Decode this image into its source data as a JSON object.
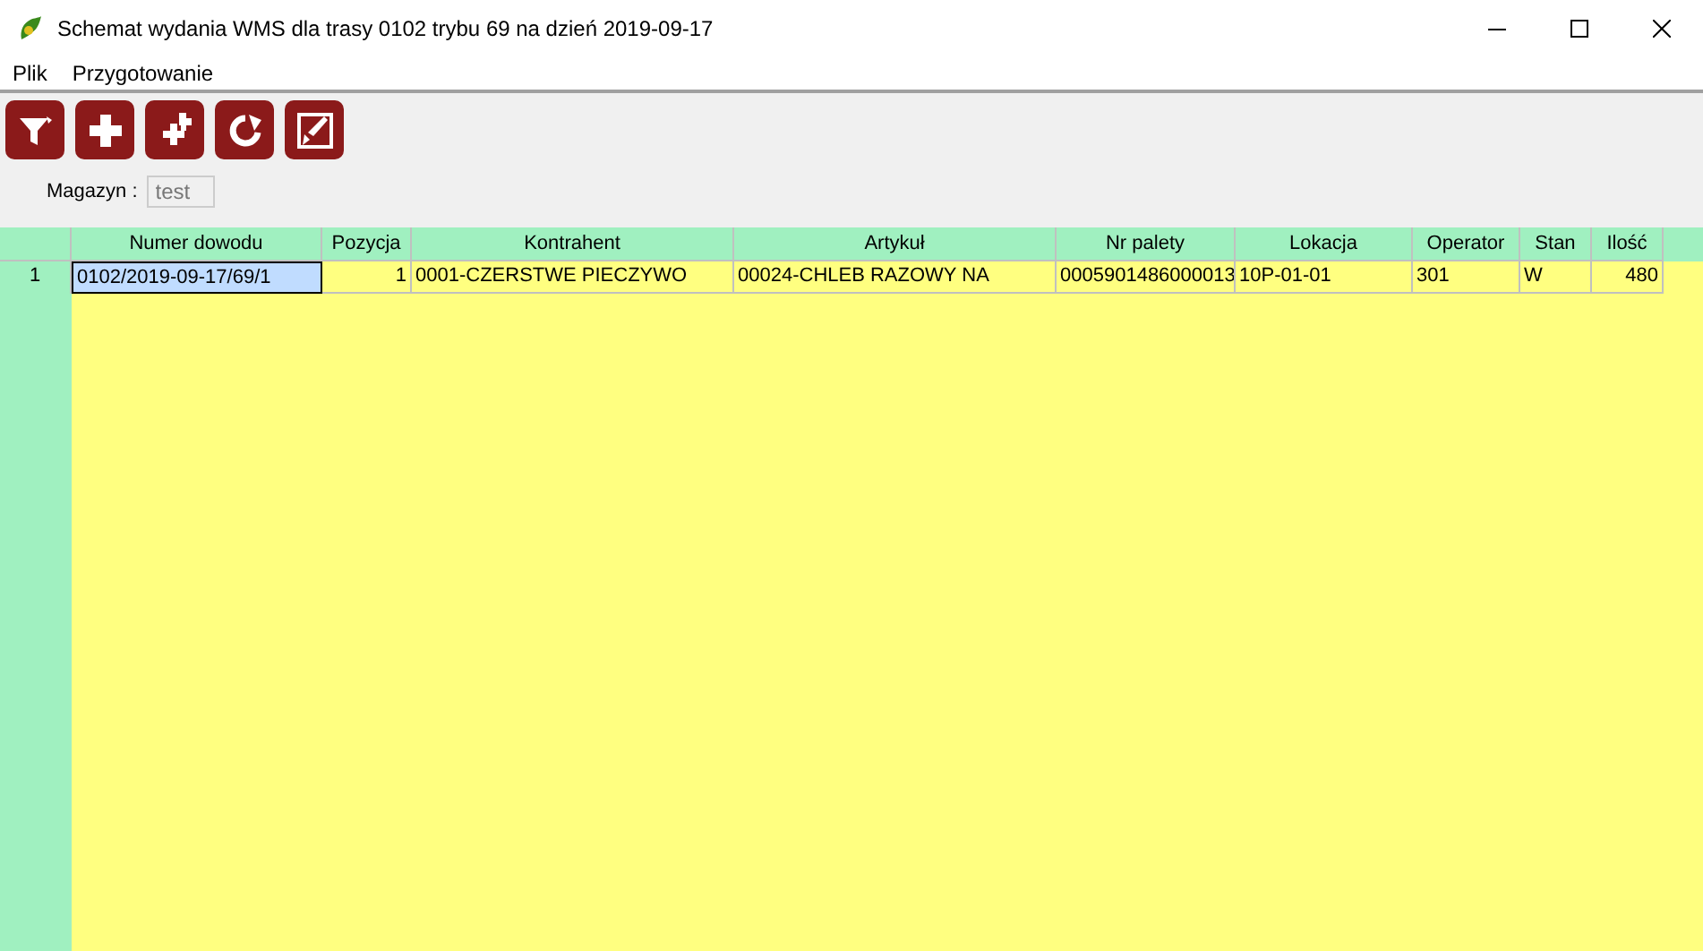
{
  "window": {
    "title": "Schemat wydania WMS dla trasy 0102 trybu 69 na dzień 2019-09-17"
  },
  "menu": [
    "Plik",
    "Przygotowanie"
  ],
  "toolbar": [
    {
      "kind": "filter"
    },
    {
      "kind": "add"
    },
    {
      "kind": "add-many"
    },
    {
      "kind": "refresh"
    },
    {
      "kind": "edit"
    }
  ],
  "magazyn": {
    "label": "Magazyn :",
    "value": "test",
    "disabled": true
  },
  "table": {
    "columns": [
      {
        "label": "Numer dowodu"
      },
      {
        "label": "Pozycja"
      },
      {
        "label": "Kontrahent"
      },
      {
        "label": "Artykuł"
      },
      {
        "label": "Nr palety"
      },
      {
        "label": "Lokacja"
      },
      {
        "label": "Operator"
      },
      {
        "label": "Stan"
      },
      {
        "label": "Ilość"
      }
    ],
    "rows": [
      {
        "number": "1",
        "cells": [
          {
            "text": "0102/2019-09-17/69/1",
            "selected": true
          },
          {
            "text": "1",
            "selected": false
          },
          {
            "text": "0001-CZERSTWE PIECZYWO",
            "selected": false
          },
          {
            "text": "00024-CHLEB RAZOWY NA",
            "selected": false
          },
          {
            "text": "0005901486000013",
            "selected": false
          },
          {
            "text": "10P-01-01",
            "selected": false
          },
          {
            "text": "301",
            "selected": false
          },
          {
            "text": "W",
            "selected": false
          },
          {
            "text": "480",
            "selected": false
          }
        ]
      }
    ]
  }
}
